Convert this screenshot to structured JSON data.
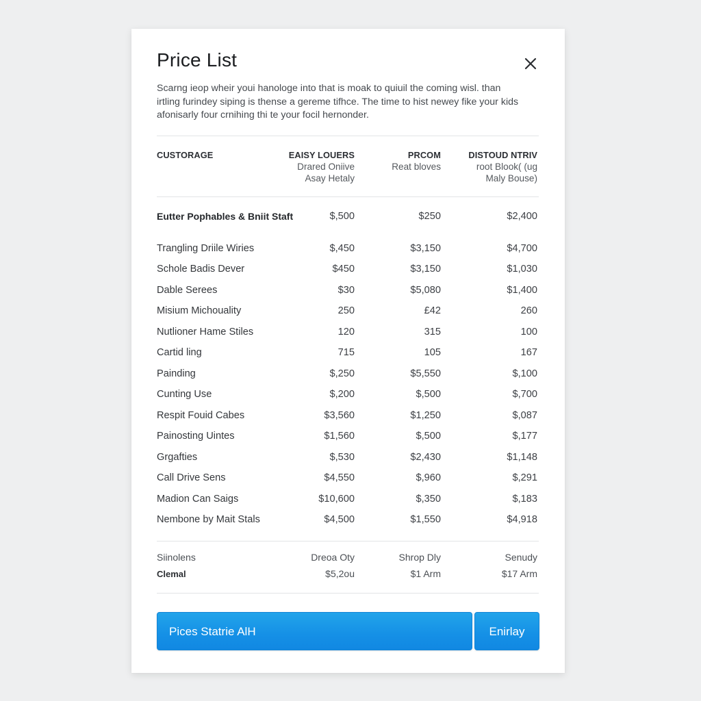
{
  "dialog": {
    "title": "Price List",
    "close_icon": "close-icon",
    "description": "Scarng ieop wheir youi hanologe into that is moak to quiuil the coming wisl. than irtling furindey siping is thense a gereme tifhce. The time to hist newey fike your kids afonisarly four crnihing thi te your focil hernonder."
  },
  "table": {
    "headers": [
      {
        "title": "CUSTORAGE",
        "sub": []
      },
      {
        "title": "EAISY LOUERS",
        "sub": [
          "Drared Oniive",
          "Asay Hetaly"
        ]
      },
      {
        "title": "PRCOM",
        "sub": [
          "Reat bloves"
        ]
      },
      {
        "title": "DISTOUD NTRIV",
        "sub": [
          "root Blook( (ug",
          "Maly Bouse)"
        ]
      }
    ],
    "rows": [
      {
        "name": "Eutter Pophables & Bniit Staft",
        "bold": true,
        "values": [
          "$,500",
          "$250",
          "$2,400"
        ]
      },
      {
        "name": "Trangling Driile Wiries",
        "values": [
          "$,450",
          "$3,150",
          "$4,700"
        ]
      },
      {
        "name": "Schole Badis Dever",
        "values": [
          "$450",
          "$3,150",
          "$1,030"
        ]
      },
      {
        "name": "Dable Serees",
        "values": [
          "$30",
          "$5,080",
          "$1,400"
        ]
      },
      {
        "name": "Misium Michouality",
        "values": [
          "250",
          "£42",
          "260"
        ]
      },
      {
        "name": "Nutlioner Hame Stiles",
        "values": [
          "120",
          "315",
          "100"
        ]
      },
      {
        "name": "Cartid ling",
        "values": [
          "715",
          "105",
          "167"
        ]
      },
      {
        "name": "Painding",
        "values": [
          "$,250",
          "$5,550",
          "$,100"
        ]
      },
      {
        "name": "Cunting Use",
        "values": [
          "$,200",
          "$,500",
          "$,700"
        ]
      },
      {
        "name": "Respit Fouid Cabes",
        "values": [
          "$3,560",
          "$1,250",
          "$,087"
        ]
      },
      {
        "name": "Painosting Uintes",
        "values": [
          "$1,560",
          "$,500",
          "$,177"
        ]
      },
      {
        "name": "Grgafties",
        "values": [
          "$,530",
          "$2,430",
          "$1,148"
        ]
      },
      {
        "name": "Call Drive Sens",
        "values": [
          "$4,550",
          "$,960",
          "$,291"
        ]
      },
      {
        "name": "Madion Can Saigs",
        "values": [
          "$10,600",
          "$,350",
          "$,183"
        ]
      },
      {
        "name": "Nembone by Mait Stals",
        "values": [
          "$4,500",
          "$1,550",
          "$4,918"
        ]
      }
    ],
    "summary": [
      {
        "label": "Siinolens",
        "values": [
          "Dreoa Oty",
          "Shrop Dly",
          "Senudy"
        ]
      },
      {
        "label": "Clemal",
        "bold": true,
        "values": [
          "$5,2ou",
          "$1 Arm",
          "$17 Arm"
        ]
      }
    ]
  },
  "actions": {
    "primary_label": "Pices Statrie AlH",
    "secondary_label": "Enirlay"
  },
  "colors": {
    "accent": "#1590e6",
    "background": "#eeeff0",
    "card": "#ffffff"
  }
}
